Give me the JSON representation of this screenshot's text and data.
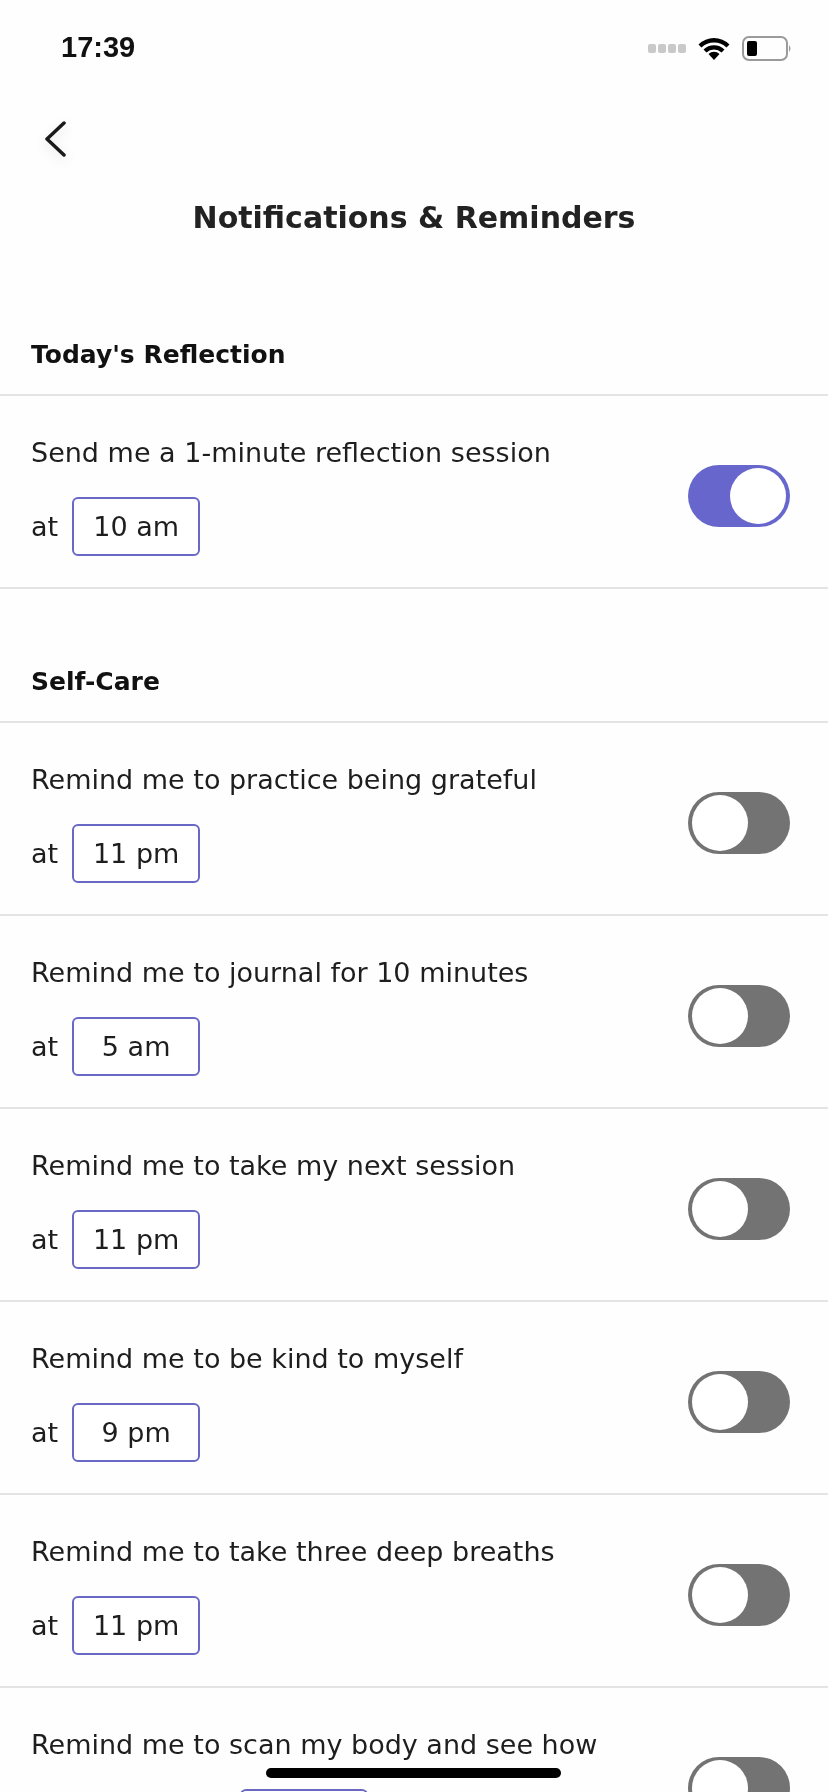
{
  "status_bar": {
    "time": "17:39"
  },
  "header": {
    "title": "Notifications & Reminders"
  },
  "sections": [
    {
      "title": "Today's Reflection",
      "reminders": [
        {
          "text": "Send me a 1-minute reflection session",
          "at_label": "at",
          "time": "10 am",
          "on": true
        }
      ]
    },
    {
      "title": "Self-Care",
      "reminders": [
        {
          "text": "Remind me to practice being grateful",
          "at_label": "at",
          "time": "11 pm",
          "on": false
        },
        {
          "text": "Remind me to journal for 10 minutes",
          "at_label": "at",
          "time": "5 am",
          "on": false
        },
        {
          "text": "Remind me to take my next session",
          "at_label": "at",
          "time": "11 pm",
          "on": false
        },
        {
          "text": "Remind me to be kind to myself",
          "at_label": "at",
          "time": "9 pm",
          "on": false
        },
        {
          "text": "Remind me to take three deep breaths",
          "at_label": "at",
          "time": "11 pm",
          "on": false
        },
        {
          "text": "Remind me to scan my body and see how",
          "on": false
        }
      ]
    }
  ]
}
